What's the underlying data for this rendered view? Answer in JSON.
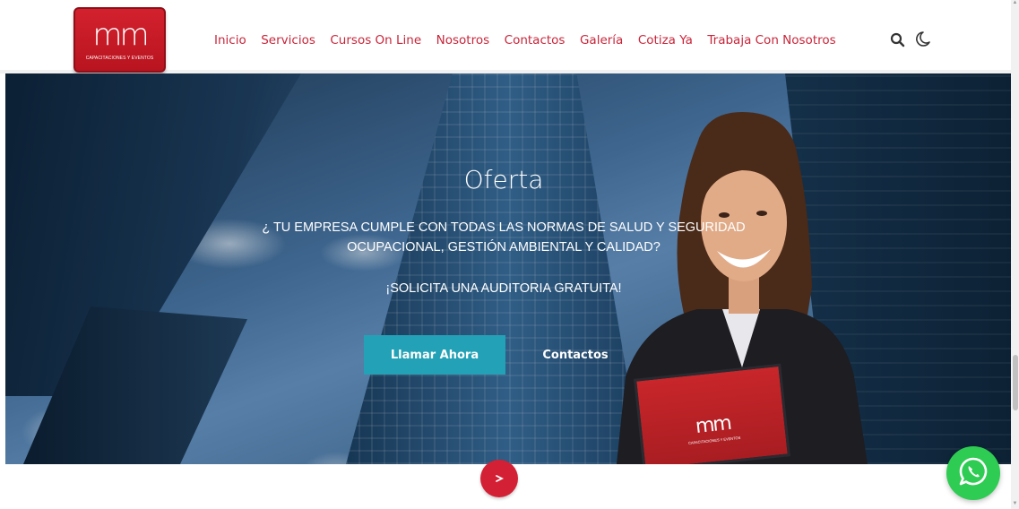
{
  "header": {
    "logo": {
      "mark": "mm",
      "tagline": "CAPACITACIONES Y EVENTOS"
    },
    "nav": [
      {
        "label": "Inicio"
      },
      {
        "label": "Servicios"
      },
      {
        "label": "Cursos On Line"
      },
      {
        "label": "Nosotros"
      },
      {
        "label": "Contactos"
      },
      {
        "label": "Galería"
      },
      {
        "label": "Cotiza Ya"
      },
      {
        "label": "Trabaja Con Nosotros"
      }
    ],
    "icons": {
      "search": "search-icon",
      "theme": "moon-icon"
    }
  },
  "hero": {
    "title": "Oferta",
    "line1": "¿ TU EMPRESA CUMPLE CON TODAS LAS NORMAS DE SALUD Y SEGURIDAD",
    "line2": "OCUPACIONAL, GESTIÓN AMBIENTAL Y CALIDAD?",
    "line3": "¡SOLICITA UNA AUDITORIA GRATUITA!",
    "primary_button": "Llamar Ahora",
    "secondary_button": "Contactos",
    "folder_logo": "mm",
    "folder_tagline": "CAPACITACIONES Y EVENTOS"
  },
  "floating": {
    "scroll_icon": "arrow-icon",
    "whatsapp_icon": "whatsapp-icon"
  },
  "colors": {
    "brand_red": "#d42035",
    "nav_red": "#c8263a",
    "teal": "#23a1b6",
    "whatsapp": "#2ecc52"
  }
}
